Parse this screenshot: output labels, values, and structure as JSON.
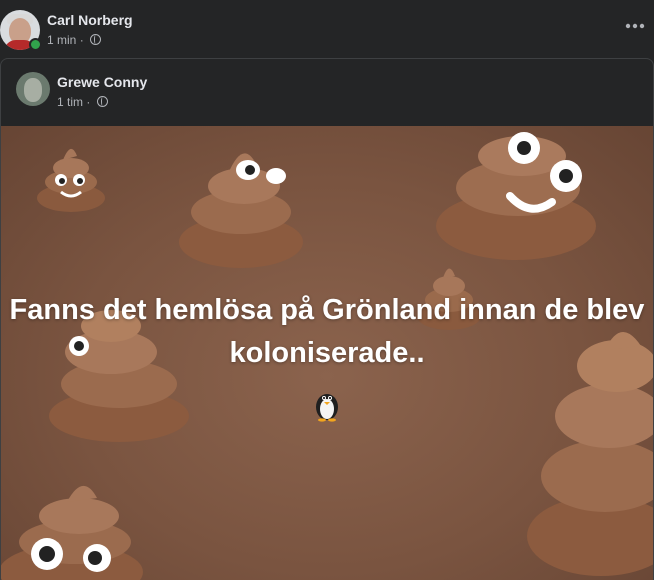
{
  "post": {
    "author": "Carl Norberg",
    "time": "1 min",
    "separator": "·",
    "privacy_icon": "globe-icon",
    "more_icon": "more-options-icon"
  },
  "shared_post": {
    "author": "Grewe Conny",
    "time": "1 tim",
    "separator": "·",
    "privacy_icon": "globe-icon",
    "text": "Fanns det hemlösa på Grönland innan de blev koloniserade..",
    "emoji_icon": "penguin-icon",
    "background": "poop-emoji-pattern"
  },
  "colors": {
    "surface": "#242526",
    "primary_text": "#e4e6eb",
    "secondary_text": "#b0b3b8",
    "online": "#31a24c",
    "background_brown": "#7a5440"
  }
}
